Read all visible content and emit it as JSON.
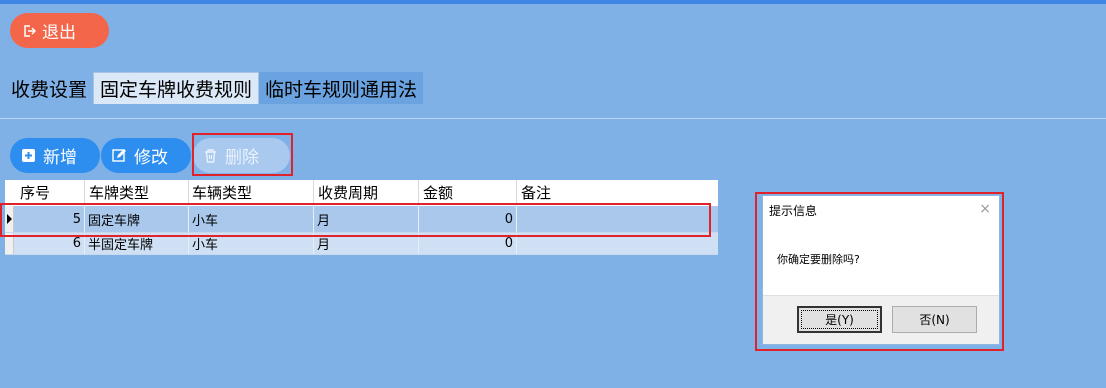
{
  "toolbar_top": {
    "exit_label": "退出"
  },
  "tabs": [
    {
      "label": "收费设置"
    },
    {
      "label": "固定车牌收费规则"
    },
    {
      "label": "临时车规则通用法"
    }
  ],
  "actions": {
    "add_label": "新增",
    "edit_label": "修改",
    "delete_label": "删除"
  },
  "table": {
    "columns": [
      "序号",
      "车牌类型",
      "车辆类型",
      "收费周期",
      "金额",
      "备注"
    ],
    "rows": [
      {
        "no": "5",
        "plate_type": "固定车牌",
        "vehicle_type": "小车",
        "period": "月",
        "amount": "0",
        "note": ""
      },
      {
        "no": "6",
        "plate_type": "半固定车牌",
        "vehicle_type": "小车",
        "period": "月",
        "amount": "0",
        "note": ""
      }
    ]
  },
  "dialog": {
    "title": "提示信息",
    "message": "你确定要删除吗?",
    "yes_label": "是(Y)",
    "no_label": "否(N)",
    "close_glyph": "×"
  },
  "colors": {
    "background": "#7fb0e6",
    "exit_button": "#f4664a",
    "action_button": "#2d8ef0",
    "highlight_box": "#e0222a"
  }
}
